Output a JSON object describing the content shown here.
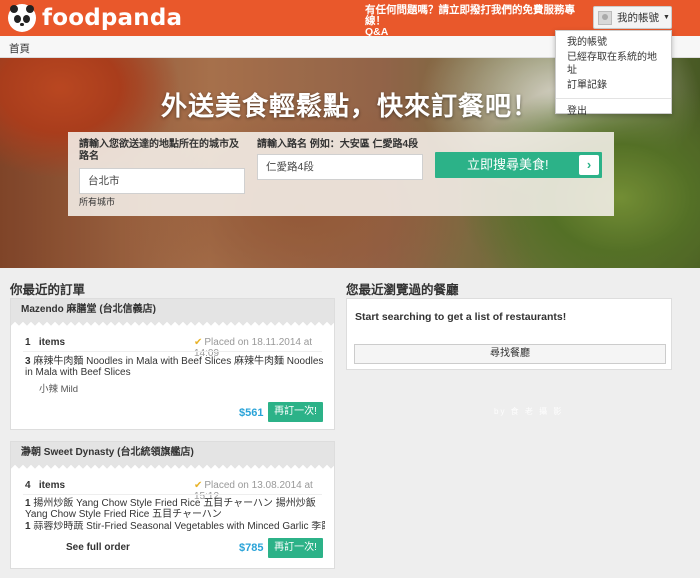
{
  "header": {
    "brand": "foodpanda",
    "help_line1": "有任何問題嗎？請立即撥打我們的免費服務專線！",
    "help_line2": "Q&A",
    "account_label": "我的帳號",
    "menu": [
      "我的帳號",
      "已經存取在系統的地址",
      "訂單記錄",
      "登出"
    ]
  },
  "breadcrumb": {
    "home": "首頁"
  },
  "hero": {
    "title": "外送美食輕鬆點，快來訂餐吧！",
    "city_label": "請輸入您欲送達的地點所在的城市及路名",
    "city_value": "台北市",
    "all_cities": "所有城市",
    "street_label": "請輸入路名 例如：大安區 仁愛路4段",
    "street_value": "仁愛路4段",
    "search_button": "立即搜尋美食!",
    "arrow": "›"
  },
  "recent_orders": {
    "title": "你最近的訂單",
    "orders": [
      {
        "restaurant": "Mazendo 麻膳堂 (台北信義店)",
        "items_count": "1",
        "items_word": "items",
        "placed": "Placed on 18.11.2014 at 14:09",
        "lines": [
          {
            "qty": "3",
            "name": "麻辣牛肉麵 Noodles in Mala with Beef Slices 麻辣牛肉麵 Noodles in Mala with Beef Slices"
          }
        ],
        "option": "小辣 Mild",
        "price": "$561",
        "reorder": "再訂一次!"
      },
      {
        "restaurant": "瀞朝 Sweet Dynasty (台北統領旗艦店)",
        "items_count": "4",
        "items_word": "items",
        "placed": "Placed on 13.08.2014 at 15:12",
        "lines": [
          {
            "qty": "1",
            "name": "揚州炒飯 Yang Chow Style Fried Rice 五目チャーハン 揚州炒飯 Yang Chow Style Fried Rice 五目チャーハン"
          },
          {
            "qty": "1",
            "name": "蒜蓉炒時蔬 Stir-Fried Seasonal Vegetables with Minced Garlic 季節"
          }
        ],
        "see_full": "See full order",
        "price": "$785",
        "reorder": "再訂一次!"
      }
    ]
  },
  "recent_restaurants": {
    "title": "您最近瀏覽過的餐廳",
    "empty_text": "Start searching to get a list of restaurants!",
    "find_button": "尋找餐廳"
  },
  "watermark": "by 食 老 攝 影",
  "colors": {
    "brand": "#e9582b",
    "accent_green": "#2cb288",
    "price_blue": "#2aa3d8",
    "check_yellow": "#e8b32a"
  },
  "icons": [
    "panda-logo-icon",
    "avatar-icon",
    "caret-down-icon",
    "arrow-right-icon",
    "check-icon"
  ]
}
